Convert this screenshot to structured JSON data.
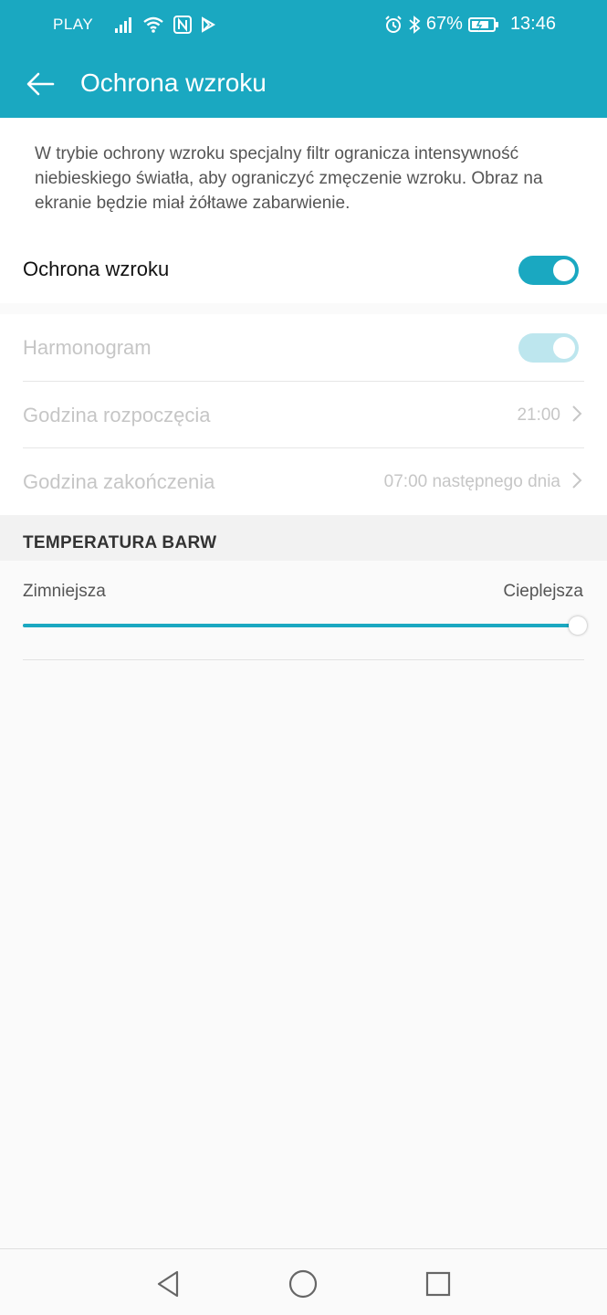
{
  "status": {
    "carrier": "PLAY",
    "battery": "67%",
    "time": "13:46"
  },
  "header": {
    "title": "Ochrona wzroku"
  },
  "intro": {
    "description": "W trybie ochrony wzroku specjalny filtr ogranicza intensywność niebieskiego światła, aby ograniczyć zmęczenie wzroku. Obraz na ekranie będzie miał żółtawe zabarwienie.",
    "toggle_label": "Ochrona wzroku",
    "toggle_on": true
  },
  "schedule": {
    "label": "Harmonogram",
    "toggle_on": true,
    "start_label": "Godzina rozpoczęcia",
    "start_value": "21:00",
    "end_label": "Godzina zakończenia",
    "end_value": "07:00 następnego dnia"
  },
  "color_temp": {
    "section_title": "TEMPERATURA BARW",
    "min_label": "Zimniejsza",
    "max_label": "Cieplejsza",
    "value_percent": 100
  },
  "colors": {
    "accent": "#1aa8c1",
    "accent_disabled": "#bde6ee"
  },
  "nav": {
    "back": "back-icon",
    "home": "home-icon",
    "recents": "recents-icon"
  }
}
